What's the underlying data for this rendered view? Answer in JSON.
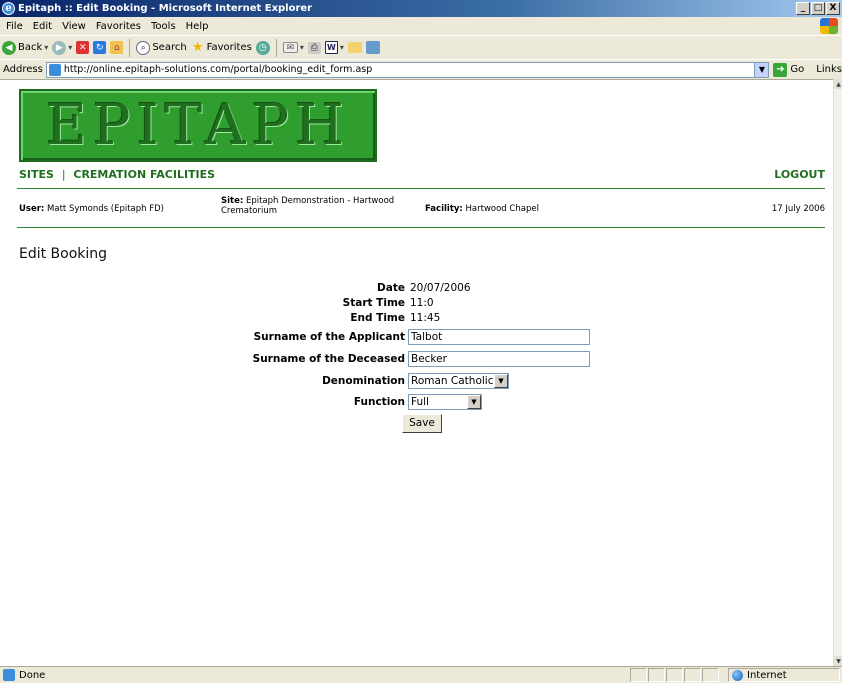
{
  "window": {
    "title": "Epitaph :: Edit Booking - Microsoft Internet Explorer",
    "buttons": [
      "_",
      "□",
      "X"
    ]
  },
  "menubar": {
    "items": [
      "File",
      "Edit",
      "View",
      "Favorites",
      "Tools",
      "Help"
    ]
  },
  "toolbar": {
    "back_label": "Back",
    "search_label": "Search",
    "favorites_label": "Favorites"
  },
  "addressbar": {
    "label": "Address",
    "url": "http://online.epitaph-solutions.com/portal/booking_edit_form.asp",
    "go_label": "Go",
    "links_label": "Links"
  },
  "page": {
    "logo_text": "EPITAPH",
    "nav": {
      "sites": "SITES",
      "separator": "|",
      "cremation_facilities": "CREMATION FACILITIES",
      "logout": "LOGOUT"
    },
    "info": {
      "user_label": "User:",
      "user_value": "Matt Symonds (Epitaph FD)",
      "site_label": "Site:",
      "site_value": "Epitaph Demonstration - Hartwood Crematorium",
      "facility_label": "Facility:",
      "facility_value": "Hartwood Chapel",
      "date": "17 July 2006"
    },
    "heading": "Edit Booking",
    "form": {
      "date_label": "Date",
      "date_value": "20/07/2006",
      "start_label": "Start Time",
      "start_value": "11:0",
      "end_label": "End Time",
      "end_value": "11:45",
      "applicant_label": "Surname of the Applicant",
      "applicant_value": "Talbot",
      "deceased_label": "Surname of the Deceased",
      "deceased_value": "Becker",
      "denomination_label": "Denomination",
      "denomination_value": "Roman Catholic",
      "function_label": "Function",
      "function_value": "Full",
      "save_label": "Save"
    }
  },
  "statusbar": {
    "status": "Done",
    "zone": "Internet"
  }
}
